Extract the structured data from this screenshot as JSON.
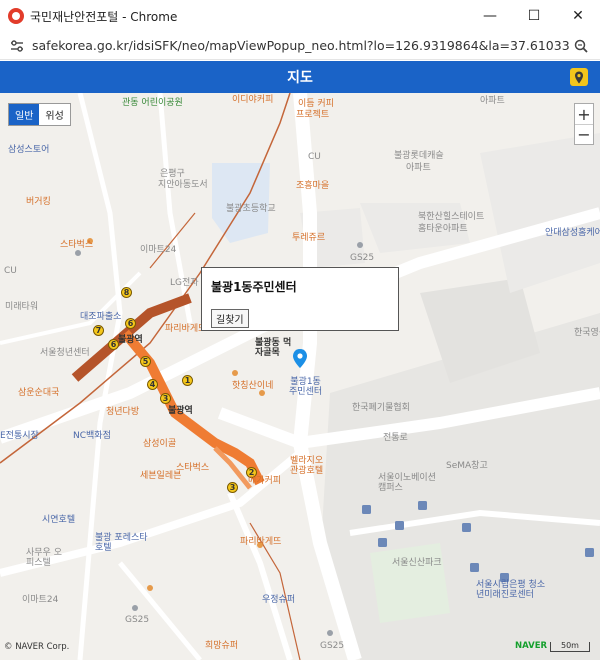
{
  "window": {
    "title": "국민재난안전포털 - Chrome",
    "url": "safekorea.go.kr/idsiSFK/neo/mapViewPopup_neo.html?lo=126.9319864&la=37.6103305&f..."
  },
  "header": {
    "title": "지도"
  },
  "map": {
    "type_normal": "일반",
    "type_satellite": "위성",
    "zoom_in": "+",
    "zoom_out": "−",
    "info_title": "불광1동주민센터",
    "info_button": "길찾기",
    "marker_label": "불광1동\n주민센터",
    "labels": [
      {
        "t": "아파트"
      },
      {
        "t": "이디야커피"
      },
      {
        "t": "관동 어린이공원"
      },
      {
        "t": "이듬 커피"
      },
      {
        "t": "프로젝트"
      },
      {
        "t": "삼성스토어"
      },
      {
        "t": "CU"
      },
      {
        "t": "불광롯데캐슬"
      },
      {
        "t": "아파트"
      },
      {
        "t": "은평구"
      },
      {
        "t": "지안아동도서"
      },
      {
        "t": "조흥마을"
      },
      {
        "t": "버거킹"
      },
      {
        "t": "불광초등학교"
      },
      {
        "t": "북한산힐스테이트"
      },
      {
        "t": "홈타운아파트"
      },
      {
        "t": "이마트24"
      },
      {
        "t": "스타벅스"
      },
      {
        "t": "투레쥬르"
      },
      {
        "t": "GS25"
      },
      {
        "t": "안대삼성홈케어"
      },
      {
        "t": "CU"
      },
      {
        "t": "LG전자"
      },
      {
        "t": "파리바게뜨"
      },
      {
        "t": "미래타워"
      },
      {
        "t": "대조파출소"
      },
      {
        "t": "불광역"
      },
      {
        "t": "불광동 먹자골목"
      },
      {
        "t": "서울청년센터"
      },
      {
        "t": "한국영상자료원"
      },
      {
        "t": "삼운순대국"
      },
      {
        "t": "청년다방"
      },
      {
        "t": "불광역"
      },
      {
        "t": "핫칭산이네"
      },
      {
        "t": "한국폐기물협회"
      },
      {
        "t": "NC백화점"
      },
      {
        "t": "삼성이골"
      },
      {
        "t": "전통로"
      },
      {
        "t": "벨라지오 관광호텔"
      },
      {
        "t": "SeMA창고"
      },
      {
        "t": "스타벅스"
      },
      {
        "t": "서울이노베이션 캠퍼스"
      },
      {
        "t": "세븐일레븐"
      },
      {
        "t": "메가커피"
      },
      {
        "t": "시연호텔"
      },
      {
        "t": "불광 포레스타호텔"
      },
      {
        "t": "파리바게뜨"
      },
      {
        "t": "서울신산파크"
      },
      {
        "t": "사무우 오피스텔"
      },
      {
        "t": "이마트24"
      },
      {
        "t": "서울시립은평 청소년미래진로센터"
      },
      {
        "t": "우정슈퍼"
      },
      {
        "t": "GS25"
      },
      {
        "t": "GS25"
      },
      {
        "t": "희망슈퍼"
      },
      {
        "t": "E전통시장"
      }
    ],
    "stations": [
      "8",
      "6",
      "7",
      "6",
      "5",
      "4",
      "3",
      "1",
      "2",
      "3"
    ],
    "copyright": "© NAVER Corp.",
    "brand": "NAVER",
    "scale": "50m"
  },
  "colors": {
    "header_blue": "#1a63c7",
    "line3_orange": "#ef7c33",
    "line6_brown": "#b5542a",
    "marker_blue": "#1b8fe6"
  }
}
